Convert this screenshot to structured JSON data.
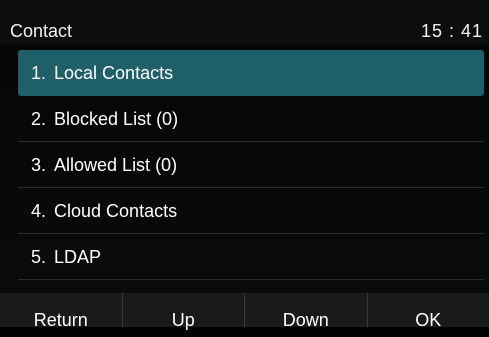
{
  "header": {
    "title": "Contact",
    "clock": "15 : 41"
  },
  "menu": {
    "selected_index": 0,
    "items": [
      {
        "number": "1.",
        "label": "Local Contacts"
      },
      {
        "number": "2.",
        "label": "Blocked List (0)"
      },
      {
        "number": "3.",
        "label": "Allowed List (0)"
      },
      {
        "number": "4.",
        "label": "Cloud Contacts"
      },
      {
        "number": "5.",
        "label": "LDAP"
      }
    ]
  },
  "softkeys": {
    "return_label": "Return",
    "up_label": "Up",
    "down_label": "Down",
    "ok_label": "OK"
  },
  "colors": {
    "selection": "#1e5f68",
    "background": "#0b0b0b",
    "softkey_bar": "#1a1a1a"
  }
}
